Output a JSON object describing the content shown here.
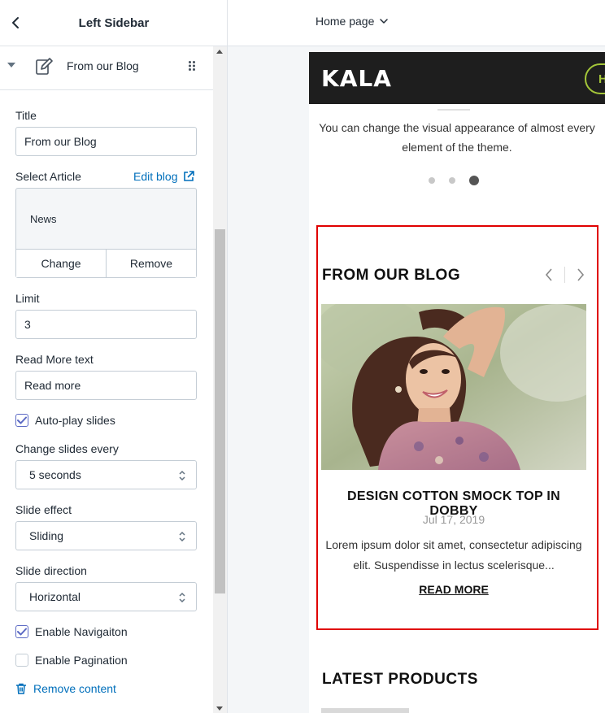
{
  "sidebar": {
    "title": "Left Sidebar",
    "section_label": "From our Blog",
    "fields": {
      "title_label": "Title",
      "title_value": "From our Blog",
      "article_label": "Select Article",
      "edit_blog": "Edit blog",
      "article_name": "News",
      "change_button": "Change",
      "remove_button": "Remove",
      "limit_label": "Limit",
      "limit_value": "3",
      "read_more_label": "Read More text",
      "read_more_value": "Read more",
      "autoplay_label": "Auto-play slides",
      "autoplay_checked": true,
      "change_every_label": "Change slides every",
      "change_every_value": "5 seconds",
      "slide_effect_label": "Slide effect",
      "slide_effect_value": "Sliding",
      "slide_direction_label": "Slide direction",
      "slide_direction_value": "Horizontal",
      "navigation_label": "Enable Navigaiton",
      "navigation_checked": true,
      "pagination_label": "Enable Pagination",
      "pagination_checked": false
    },
    "remove_content": "Remove content"
  },
  "topbar": {
    "page_select": "Home page"
  },
  "preview": {
    "logo": "KALA",
    "header_pill": "H",
    "slide_text": "You can change the visual appearance of almost every element of the theme.",
    "slide_dots": 3,
    "active_dot": 3,
    "blog_heading": "FROM OUR BLOG",
    "post": {
      "title": "DESIGN COTTON SMOCK TOP IN DOBBY",
      "date": "Jul 17, 2019",
      "excerpt": "Lorem ipsum dolor sit amet, consectetur adipiscing elit. Suspendisse in lectus scelerisque...",
      "read_more": "READ MORE"
    },
    "latest_heading": "LATEST PRODUCTS"
  },
  "colors": {
    "link": "#006fbb",
    "highlight": "#e00000",
    "store_header": "#1e1e1e",
    "accent": "#a4c639"
  }
}
